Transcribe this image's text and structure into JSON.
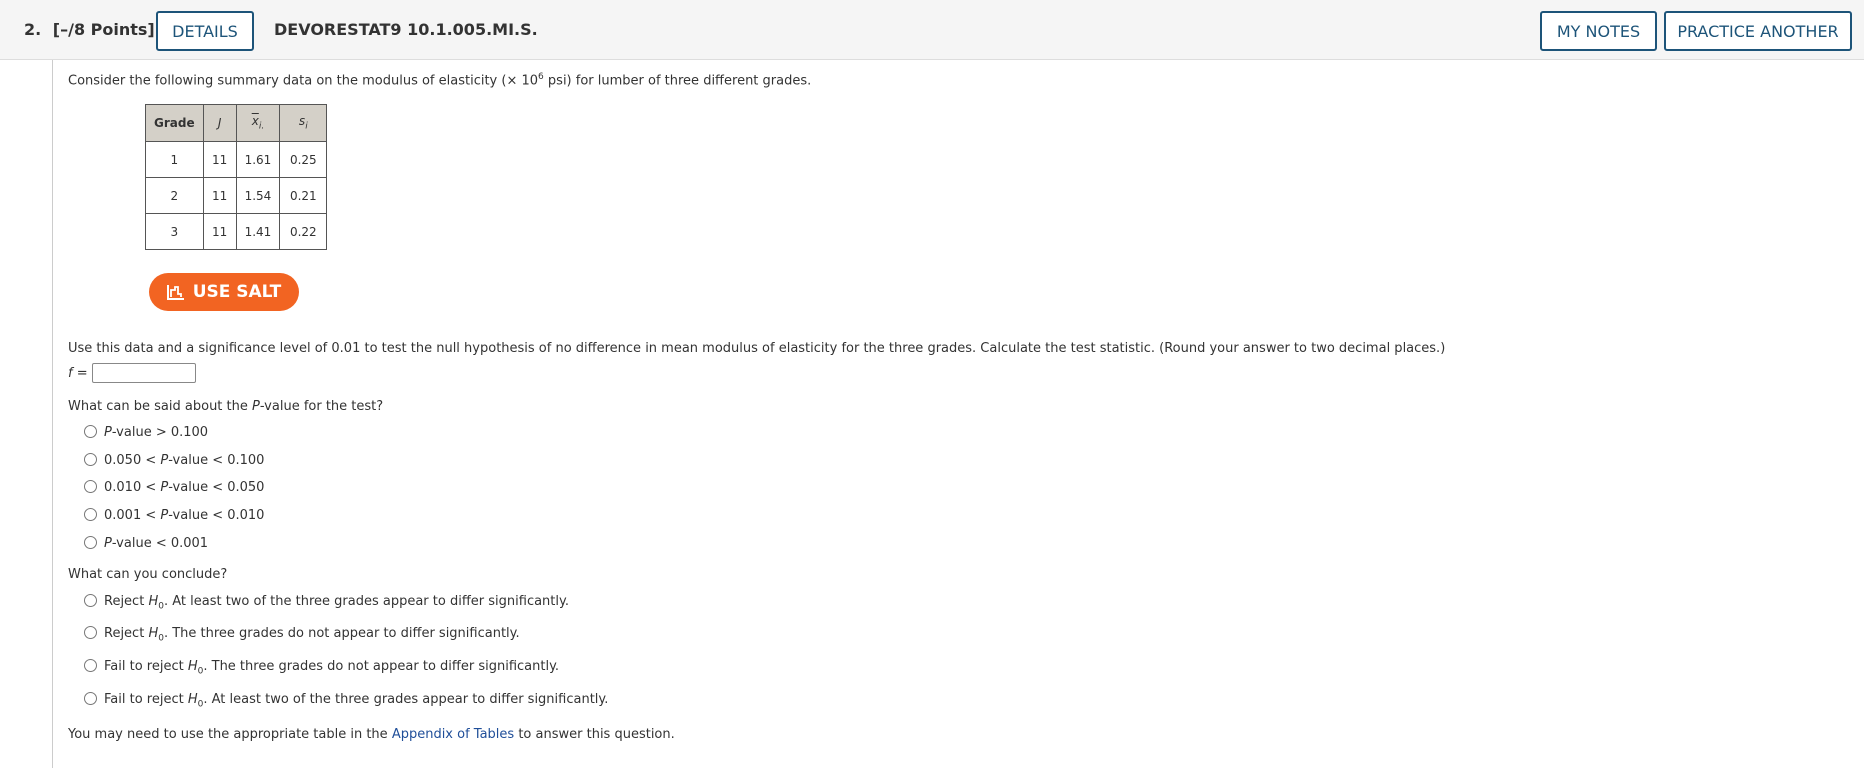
{
  "header": {
    "question_number": "2.",
    "points": "[–/8 Points]",
    "details_label": "DETAILS",
    "problem_code": "DEVORESTAT9 10.1.005.MI.S.",
    "my_notes_label": "MY NOTES",
    "practice_another_label": "PRACTICE ANOTHER"
  },
  "intro": {
    "part1": "Consider the following summary data on the modulus of elasticity (",
    "times": "×",
    "ten": "10",
    "exponent": "6",
    "part2": " psi) for lumber of three different grades."
  },
  "table": {
    "headers": {
      "grade": "Grade",
      "j": "J",
      "xbar": "x",
      "xbar_sub": "i.",
      "s": "s",
      "s_sub": "i"
    },
    "rows": [
      {
        "grade": "1",
        "j": "11",
        "xbar": "1.61",
        "s": "0.25"
      },
      {
        "grade": "2",
        "j": "11",
        "xbar": "1.54",
        "s": "0.21"
      },
      {
        "grade": "3",
        "j": "11",
        "xbar": "1.41",
        "s": "0.22"
      }
    ]
  },
  "salt_label": "USE SALT",
  "question1": {
    "text": "Use this data and a significance level of 0.01 to test the null hypothesis of no difference in mean modulus of elasticity for the three grades. Calculate the test statistic. (Round your answer to two decimal places.)",
    "answer_label": "f =",
    "answer_value": ""
  },
  "question2": {
    "text_before": "What can be said about the ",
    "text_p": "P",
    "text_after": "-value for the test?",
    "options": [
      {
        "pre": "",
        "p": "P",
        "post": "-value > 0.100"
      },
      {
        "pre": "0.050 < ",
        "p": "P",
        "post": "-value < 0.100"
      },
      {
        "pre": "0.010 < ",
        "p": "P",
        "post": "-value < 0.050"
      },
      {
        "pre": "0.001 < ",
        "p": "P",
        "post": "-value < 0.010"
      },
      {
        "pre": "",
        "p": "P",
        "post": "-value < 0.001"
      }
    ]
  },
  "question3": {
    "text": "What can you conclude?",
    "options": [
      {
        "pre": "Reject ",
        "h": "H",
        "sub": "0",
        "post": ". At least two of the three grades appear to differ significantly."
      },
      {
        "pre": "Reject ",
        "h": "H",
        "sub": "0",
        "post": ". The three grades do not appear to differ significantly."
      },
      {
        "pre": "Fail to reject ",
        "h": "H",
        "sub": "0",
        "post": ". The three grades do not appear to differ significantly."
      },
      {
        "pre": "Fail to reject ",
        "h": "H",
        "sub": "0",
        "post": ". At least two of the three grades appear to differ significantly."
      }
    ]
  },
  "footer": {
    "pre": "You may need to use the appropriate table in the ",
    "link": "Appendix of Tables",
    "post": " to answer this question."
  },
  "colors": {
    "brand_blue": "#1d5479",
    "salt_orange": "#f26422",
    "link_blue": "#1f4e99"
  }
}
